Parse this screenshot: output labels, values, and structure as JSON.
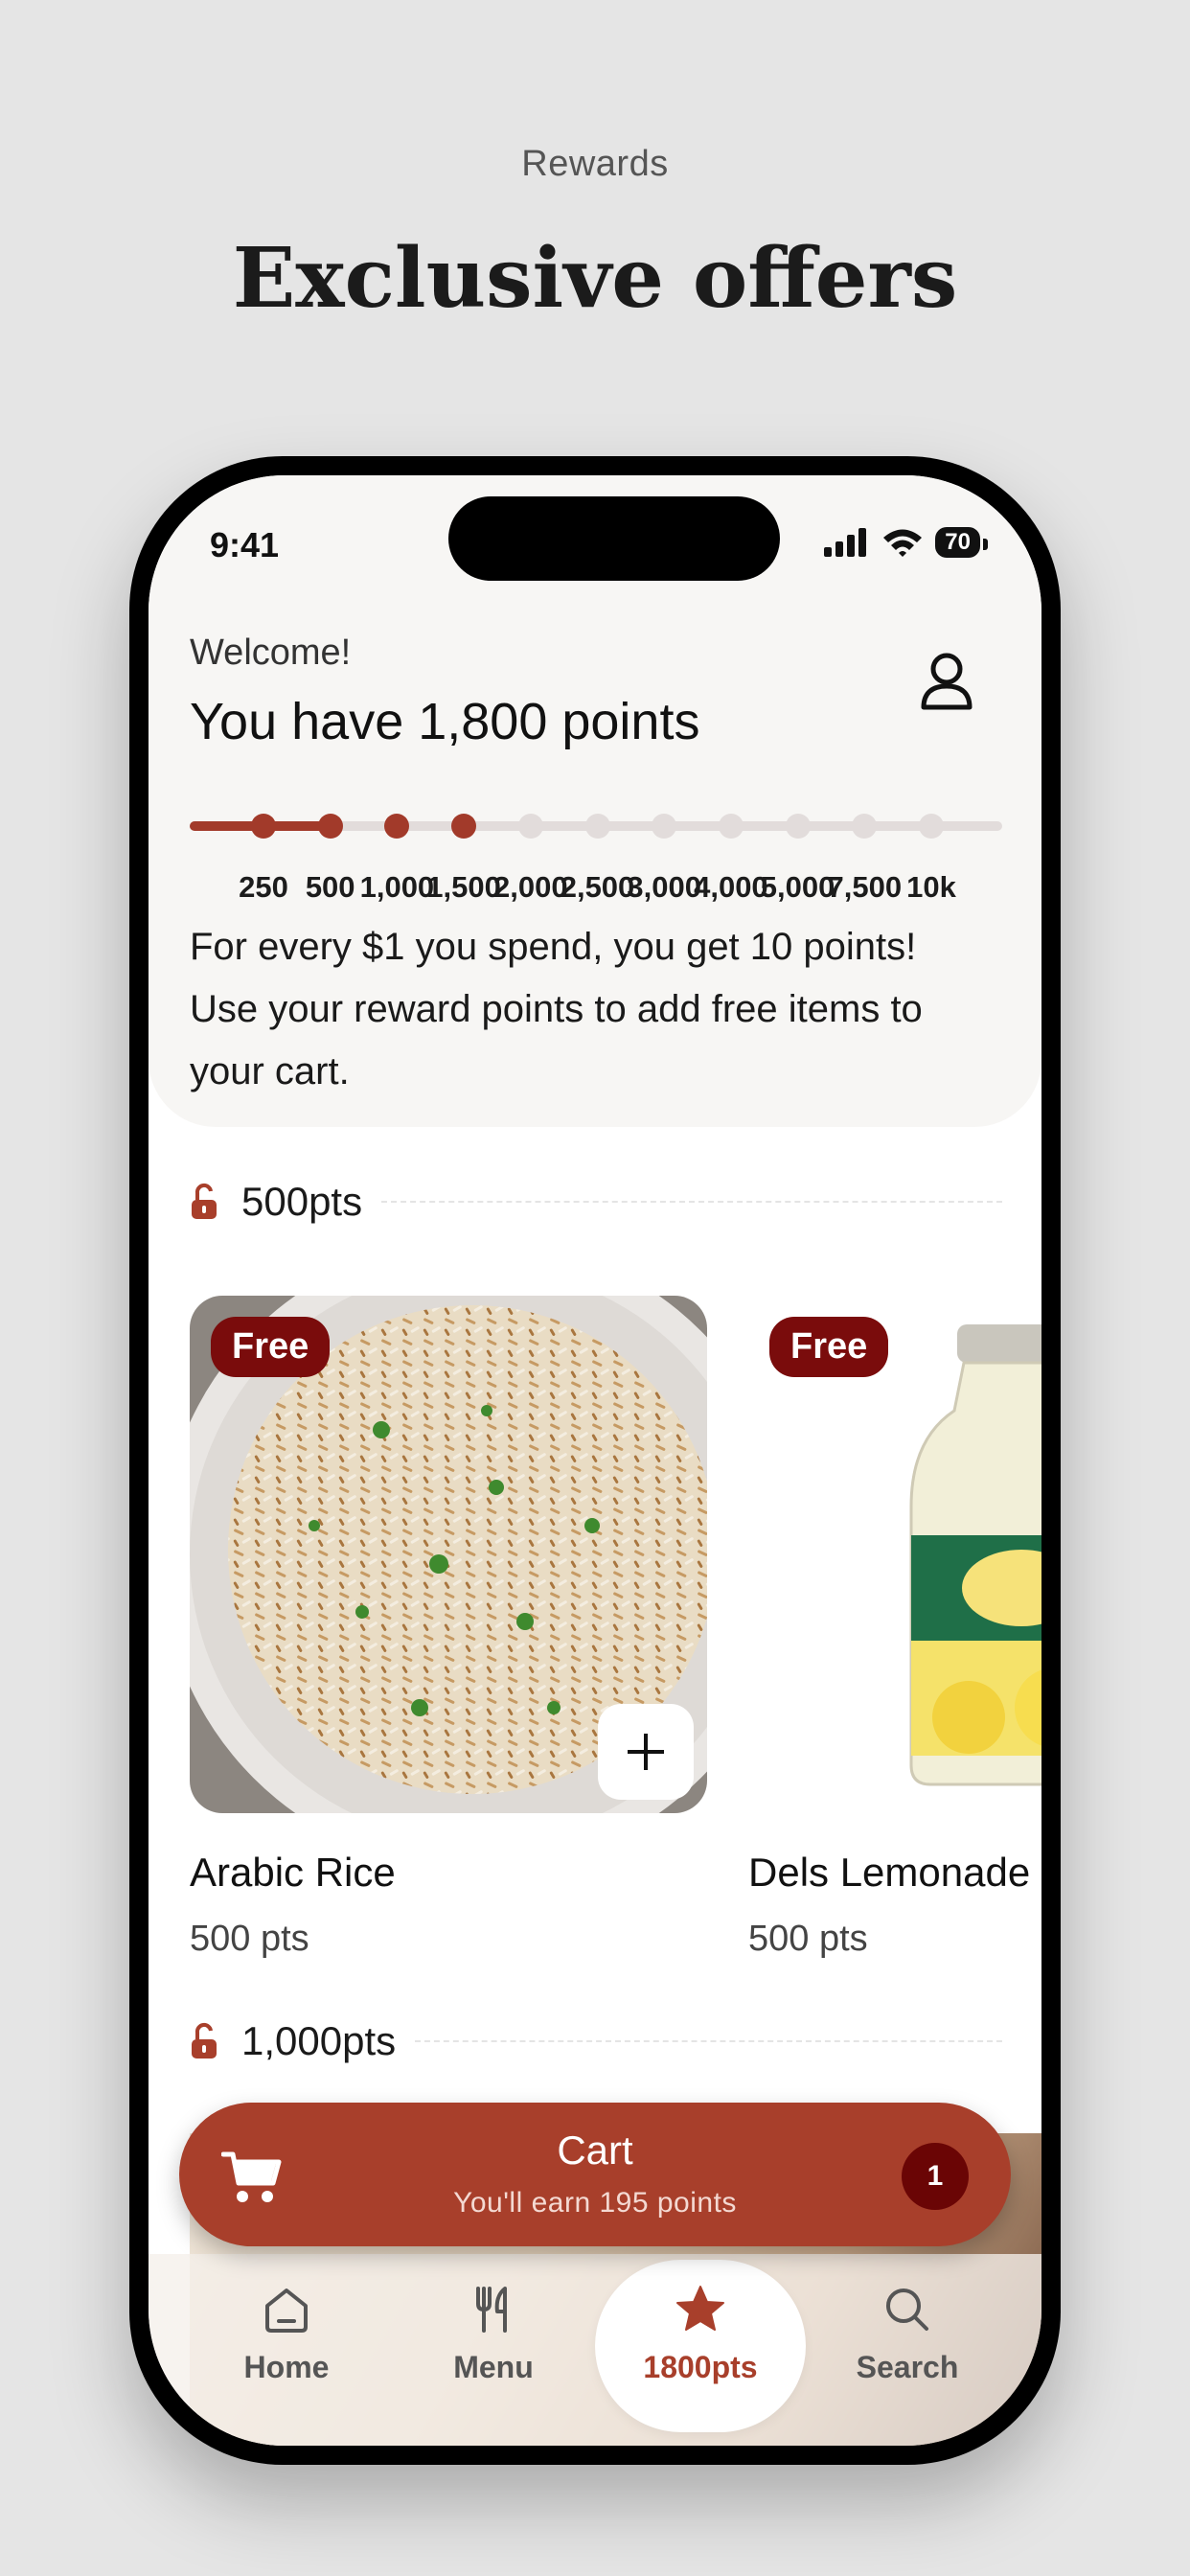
{
  "page": {
    "eyebrow": "Rewards",
    "title": "Exclusive offers"
  },
  "status_bar": {
    "time": "9:41",
    "battery": "70"
  },
  "header": {
    "welcome": "Welcome!",
    "points_title": "You have 1,800 points",
    "progress": {
      "current_points": 1800,
      "milestones": [
        "250",
        "500",
        "1,000",
        "1,500",
        "2,000",
        "2,500",
        "3,000",
        "4,000",
        "5,000",
        "7,500",
        "10k"
      ],
      "reached_count": 4
    },
    "info": "For every $1 you spend, you get 10 points! Use your reward points to add free items to your cart."
  },
  "tiers": [
    {
      "label": "500pts"
    },
    {
      "label": "1,000pts"
    }
  ],
  "products": [
    {
      "badge": "Free",
      "name": "Arabic Rice",
      "price": "500 pts"
    },
    {
      "badge": "Free",
      "name": "Dels Lemonade",
      "price": "500 pts"
    }
  ],
  "cart": {
    "title": "Cart",
    "subtitle": "You'll earn 195 points",
    "count": "1"
  },
  "tabs": [
    {
      "label": "Home",
      "icon": "home-icon"
    },
    {
      "label": "Menu",
      "icon": "fork-knife-icon"
    },
    {
      "label": "1800pts",
      "icon": "star-icon",
      "active": true
    },
    {
      "label": "Search",
      "icon": "search-icon"
    }
  ],
  "colors": {
    "accent": "#a83f2b",
    "badge": "#7a0c0c",
    "track": "#e2dcdb"
  }
}
